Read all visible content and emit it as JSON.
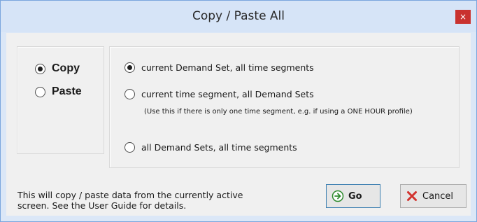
{
  "window": {
    "title": "Copy / Paste All",
    "close_glyph": "×"
  },
  "mode": {
    "selected": "copy",
    "options": [
      {
        "id": "copy",
        "label": "Copy",
        "checked": true
      },
      {
        "id": "paste",
        "label": "Paste",
        "checked": false
      }
    ]
  },
  "scope": {
    "options": [
      {
        "label": "current Demand Set, all time segments",
        "checked": true
      },
      {
        "label": "current time segment, all Demand Sets",
        "checked": false
      },
      {
        "label": "all Demand Sets, all time segments",
        "checked": false
      }
    ],
    "note": "(Use this if there is only one time segment, e.g. if using a ONE HOUR profile)"
  },
  "footer": {
    "info_line1": "This will copy / paste data from the currently active",
    "info_line2": "screen.  See the User Guide for details."
  },
  "buttons": {
    "go": {
      "label": "Go",
      "icon": "arrow-right-circle-icon",
      "color": "#2e8b2e"
    },
    "cancel": {
      "label": "Cancel",
      "icon": "x-icon",
      "color": "#d2322d"
    }
  },
  "colors": {
    "titlebar": "#d6e4f7",
    "border": "#7aa6dd",
    "close_button": "#c9322f",
    "client_background": "#f0f0f0"
  }
}
